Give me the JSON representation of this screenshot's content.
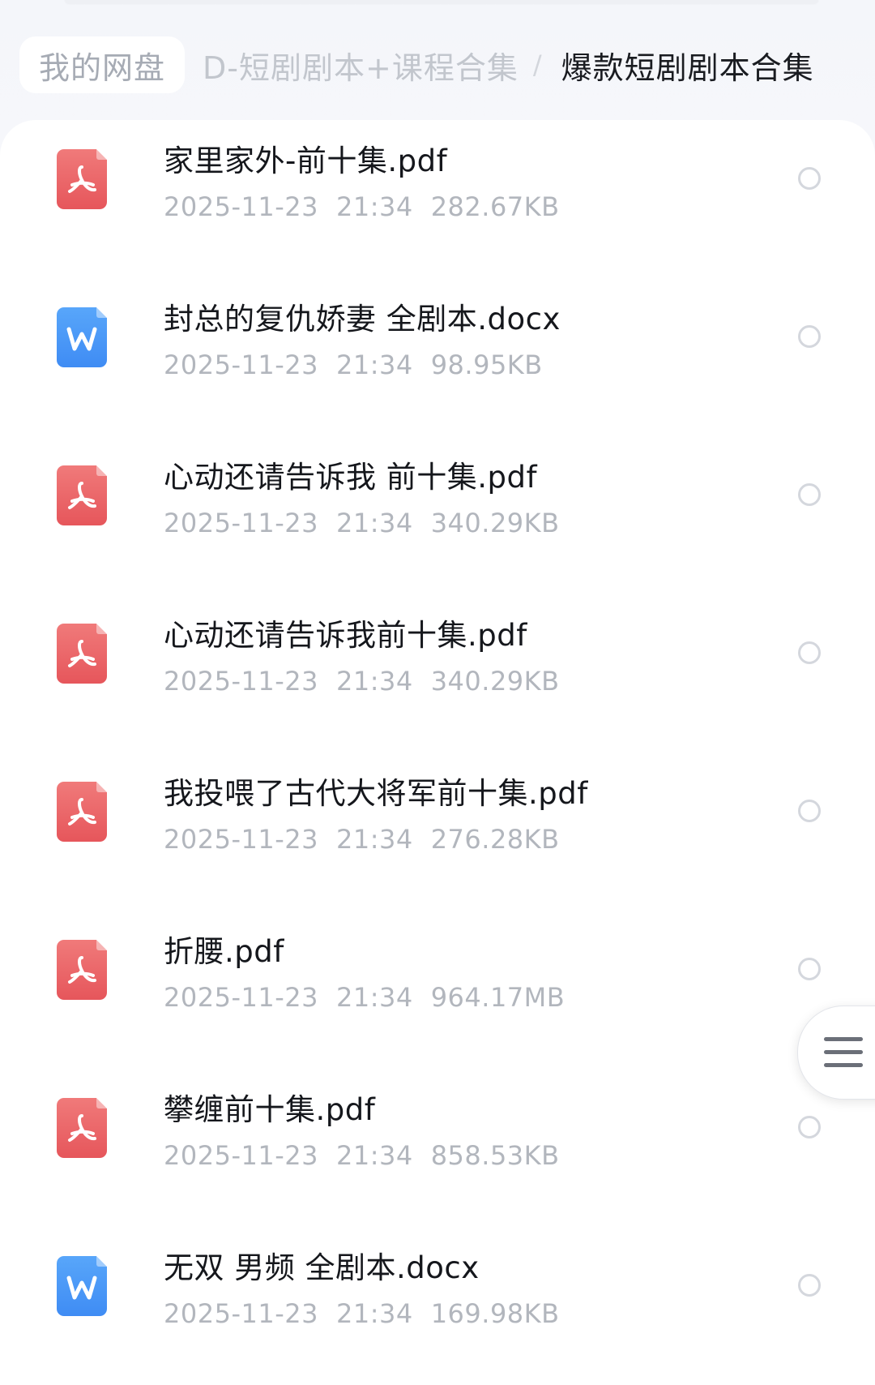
{
  "breadcrumb": {
    "home": "我的网盘",
    "parent": "D-短剧剧本+课程合集",
    "separator": "/",
    "current": "爆款短剧剧本合集"
  },
  "files": [
    {
      "name": "家里家外-前十集.pdf",
      "date": "2025-11-23",
      "time": "21:34",
      "size": "282.67KB",
      "type": "pdf",
      "icon": "pdf-icon"
    },
    {
      "name": "封总的复仇娇妻 全剧本.docx",
      "date": "2025-11-23",
      "time": "21:34",
      "size": "98.95KB",
      "type": "docx",
      "icon": "word-icon"
    },
    {
      "name": "心动还请告诉我 前十集.pdf",
      "date": "2025-11-23",
      "time": "21:34",
      "size": "340.29KB",
      "type": "pdf",
      "icon": "pdf-icon"
    },
    {
      "name": "心动还请告诉我前十集.pdf",
      "date": "2025-11-23",
      "time": "21:34",
      "size": "340.29KB",
      "type": "pdf",
      "icon": "pdf-icon"
    },
    {
      "name": "我投喂了古代大将军前十集.pdf",
      "date": "2025-11-23",
      "time": "21:34",
      "size": "276.28KB",
      "type": "pdf",
      "icon": "pdf-icon"
    },
    {
      "name": "折腰.pdf",
      "date": "2025-11-23",
      "time": "21:34",
      "size": "964.17MB",
      "type": "pdf",
      "icon": "pdf-icon"
    },
    {
      "name": "攀缠前十集.pdf",
      "date": "2025-11-23",
      "time": "21:34",
      "size": "858.53KB",
      "type": "pdf",
      "icon": "pdf-icon"
    },
    {
      "name": "无双 男频 全剧本.docx",
      "date": "2025-11-23",
      "time": "21:34",
      "size": "169.98KB",
      "type": "docx",
      "icon": "word-icon"
    }
  ],
  "float_menu": {
    "icon": "menu-icon"
  },
  "colors": {
    "pdf": "#e6565b",
    "docx": "#3f8cf4",
    "text_primary": "#15171c",
    "text_secondary": "#b2b6bd"
  }
}
